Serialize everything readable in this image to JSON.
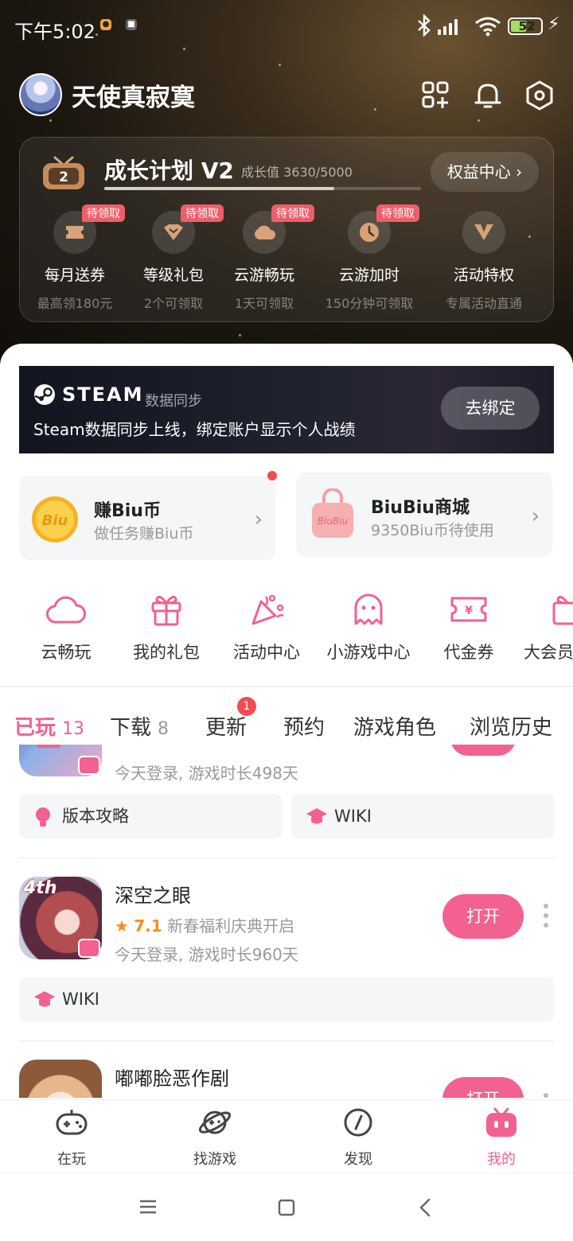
{
  "status_bar": {
    "time": "下午5:02",
    "battery": "52",
    "battery_level": 0.52
  },
  "profile": {
    "username": "天使真寂寞"
  },
  "growth_plan": {
    "tier_badge": "2",
    "title": "成长计划 V2",
    "value_text": "成长值 3630/5000",
    "progress": 0.726,
    "benefits_button": "权益中心",
    "perks": [
      {
        "label": "每月送券",
        "sub": "最高领180元",
        "tag": "待领取"
      },
      {
        "label": "等级礼包",
        "sub": "2个可领取",
        "tag": "待领取"
      },
      {
        "label": "云游畅玩",
        "sub": "1天可领取",
        "tag": "待领取"
      },
      {
        "label": "云游加时",
        "sub": "150分钟可领取",
        "tag": "待领取"
      },
      {
        "label": "活动特权",
        "sub": "专属活动直通",
        "tag": ""
      }
    ]
  },
  "steam_banner": {
    "brand": "STEAM",
    "tag": "数据同步",
    "desc": "Steam数据同步上线，绑定账户显示个人战绩",
    "button": "去绑定"
  },
  "coin_cards": [
    {
      "title": "赚Biu币",
      "sub": "做任务赚Biu币",
      "icon_text": "Biu"
    },
    {
      "title": "BiuBiu商城",
      "sub": "9350Biu币待使用",
      "icon_text": "BiuBiu"
    }
  ],
  "quick_actions": [
    {
      "label": "云畅玩",
      "icon": "cloud-icon"
    },
    {
      "label": "我的礼包",
      "icon": "gift-icon"
    },
    {
      "label": "活动中心",
      "icon": "party-popper-icon"
    },
    {
      "label": "小游戏中心",
      "icon": "ghost-icon"
    },
    {
      "label": "代金券",
      "icon": "ticket-icon"
    },
    {
      "label": "大会员",
      "icon": "member-gift-icon"
    }
  ],
  "tabs": [
    {
      "label": "已玩",
      "count": "13"
    },
    {
      "label": "下载",
      "count": "8"
    },
    {
      "label": "更新",
      "badge": "1"
    },
    {
      "label": "预约"
    },
    {
      "label": "游戏角色"
    },
    {
      "label": "浏览历史"
    }
  ],
  "games": [
    {
      "name": "",
      "meta": "今天登录, 游戏时长498天",
      "pills": [
        "版本攻略",
        "WIKI"
      ]
    },
    {
      "name": "深空之眼",
      "rating": "7.1",
      "promo": "新春福利庆典开启",
      "meta": "今天登录, 游戏时长960天",
      "icon_text": "4th",
      "button": "打开",
      "pills": [
        "WIKI"
      ]
    },
    {
      "name": "嘟嘟脸恶作剧",
      "button": "打开"
    }
  ],
  "bottom_nav": [
    {
      "label": "在玩",
      "icon": "gamepad-icon"
    },
    {
      "label": "找游戏",
      "icon": "planet-icon"
    },
    {
      "label": "发现",
      "icon": "compass-icon"
    },
    {
      "label": "我的",
      "icon": "bilibili-tv-icon"
    }
  ],
  "colors": {
    "accent": "#f2618f",
    "rating": "#ff8a1c",
    "tag_red": "#ee5e6a"
  }
}
